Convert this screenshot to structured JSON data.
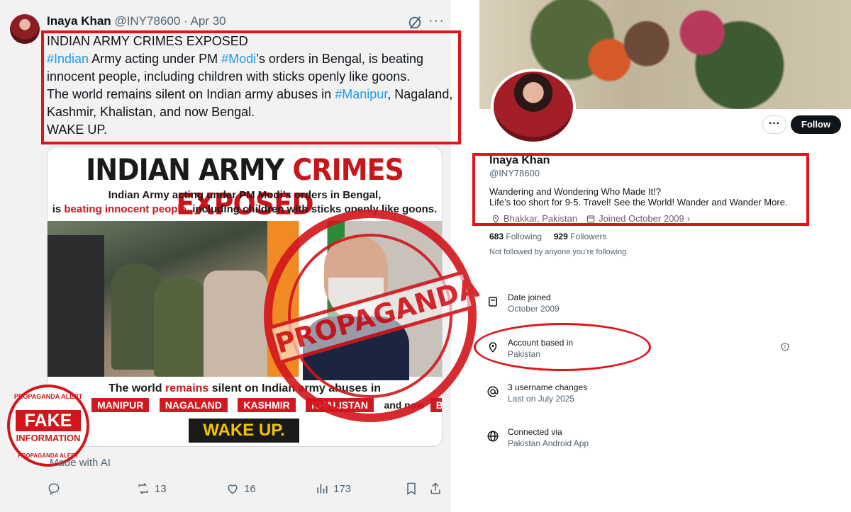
{
  "tweet": {
    "author_name": "Inaya Khan",
    "handle": "@INY78600",
    "separator": "·",
    "date": "Apr 30",
    "more": "···",
    "lines": {
      "l1": "INDIAN ARMY CRIMES EXPOSED",
      "l2_tag1": "#Indian",
      "l2_mid": " Army acting under PM ",
      "l2_tag2": "#Modi",
      "l2_end": "’s orders in Bengal, is beating",
      "l3": "innocent people, including children with sticks openly like goons.",
      "l4_start": "The world remains silent on Indian army abuses in ",
      "l4_tag": "#Manipur",
      "l4_end": ", Nagaland,",
      "l5": "Kashmir, Khalistan, and now Bengal.",
      "l6": "WAKE UP."
    },
    "media": {
      "title_dark": "INDIAN ARMY ",
      "title_red": "CRIMES EXPOSED",
      "sub1": "Indian Army acting under PM Modi’s orders in Bengal,",
      "sub2_start": "is ",
      "sub2_red": "beating innocent people,",
      "sub2_end": " including children with sticks openly like goons.",
      "world_start": "The world ",
      "world_red": "remains",
      "world_end": " silent on Indian army abuses in",
      "regions": [
        "MANIPUR",
        "NAGALAND",
        "KASHMIR",
        "KHALISTAN"
      ],
      "and_now": "and now",
      "bengal": "BENGAL.",
      "wake_up": "WAKE UP."
    },
    "stamp_propaganda": "PROPAGANDA",
    "stamp_fake": {
      "ring_top": "PROPAGANDA ALERT",
      "fake": "FAKE",
      "information": "INFORMATION",
      "ring_bottom": "PROPAGANDA ALERT"
    },
    "made_with_ai": "Made with AI",
    "actions": {
      "retweets": "13",
      "likes": "16",
      "views": "173"
    }
  },
  "profile": {
    "more": "···",
    "follow_label": "Follow",
    "name": "Inaya Khan",
    "handle": "@INY78600",
    "bio_line1": "Wandering and Wondering Who Made It!?",
    "bio_line2": "Life’s too short for 9-5. Travel! See the World! Wander and Wander More.",
    "location": "Bhakkar, Pakistan",
    "joined": "Joined October 2009",
    "following_count": "683",
    "following_label": "Following",
    "followers_count": "929",
    "followers_label": "Followers",
    "not_followed": "Not followed by anyone you’re following",
    "about": [
      {
        "label": "Date joined",
        "value": "October 2009",
        "icon": "calendar-icon"
      },
      {
        "label": "Account based in",
        "value": "Pakistan",
        "icon": "location-pin-icon"
      },
      {
        "label": "3 username changes",
        "value": "Last on July 2025",
        "icon": "at-sign-icon"
      },
      {
        "label": "Connected via",
        "value": "Pakistan Android App",
        "icon": "globe-icon"
      }
    ]
  },
  "colors": {
    "highlight_red": "#e1141b",
    "hashtag_blue": "#1d9bf0",
    "follow_button": "#0f1419"
  }
}
